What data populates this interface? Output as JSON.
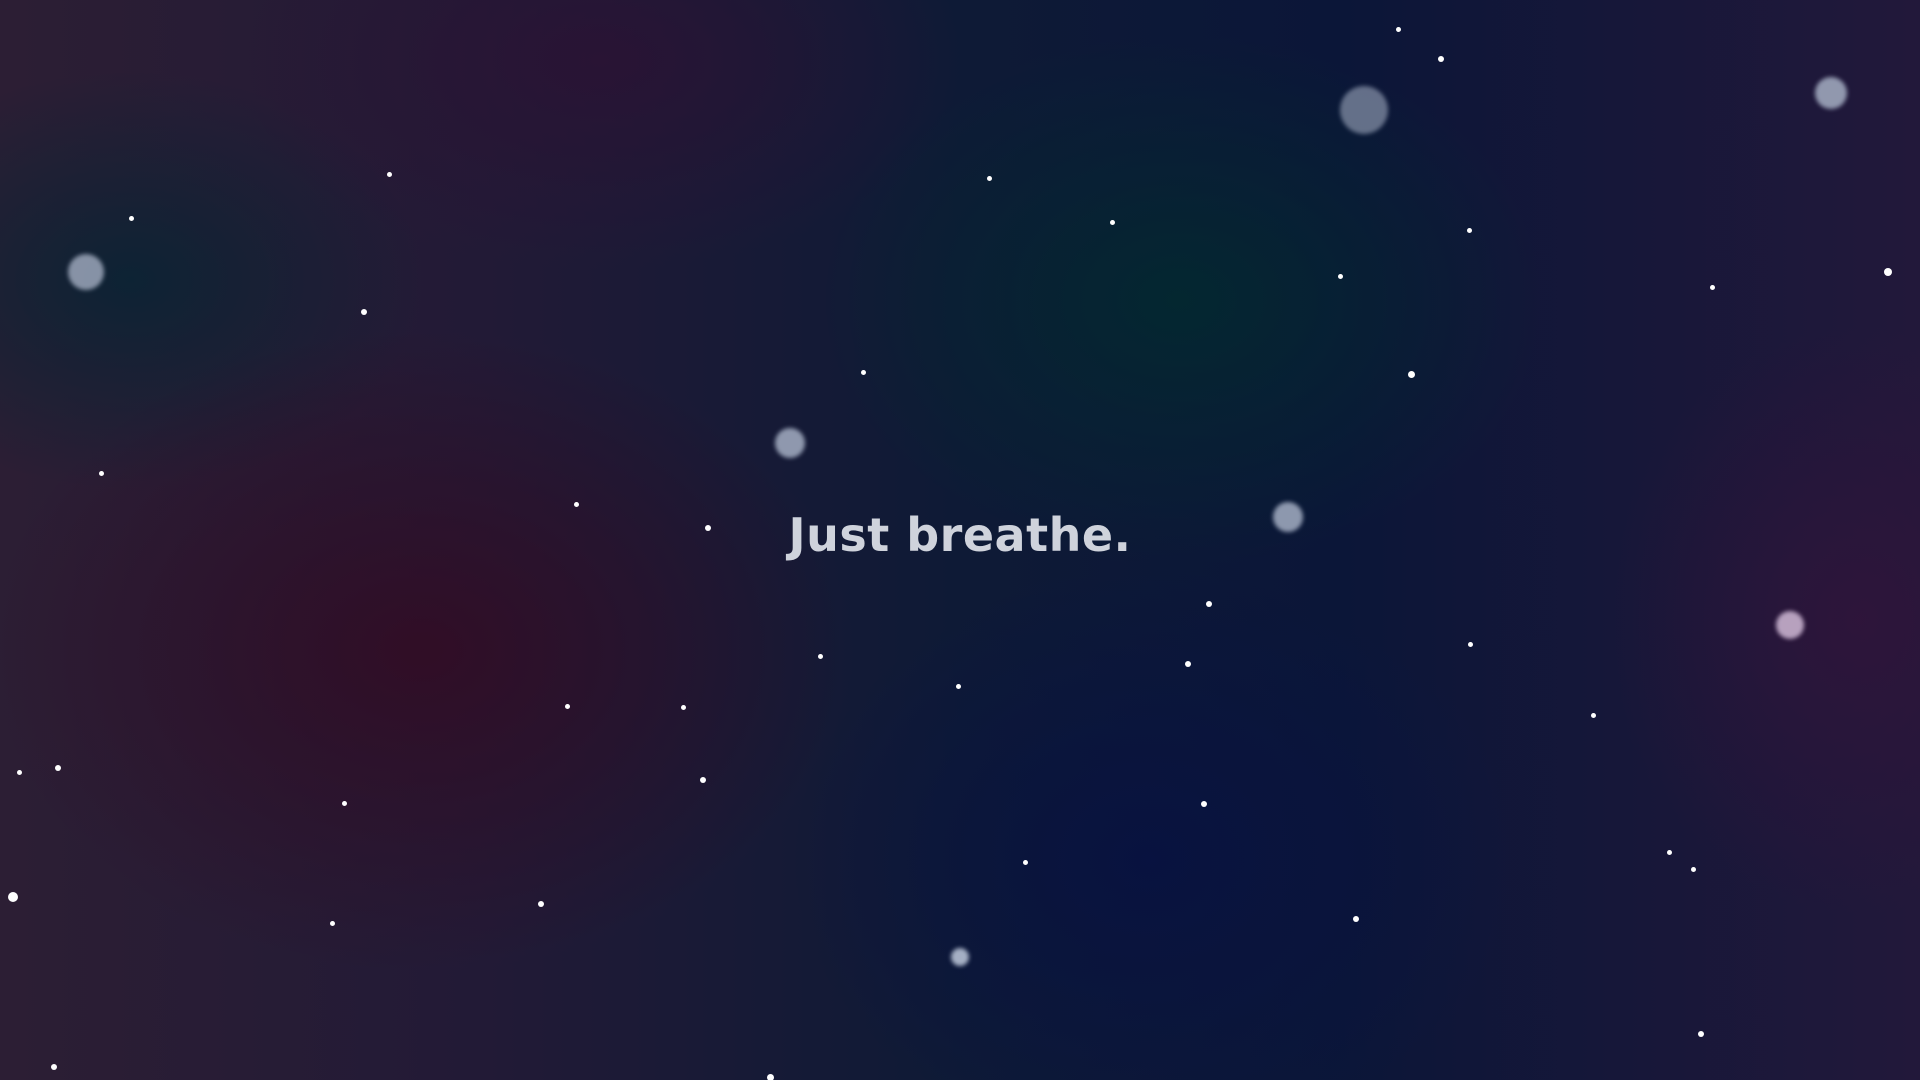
{
  "message": "Just breathe.",
  "colors": {
    "text": "#cfd3dc",
    "star": "#ffffff",
    "orb": "#aeb8cc",
    "orb_pink": "#d0bad6"
  }
}
